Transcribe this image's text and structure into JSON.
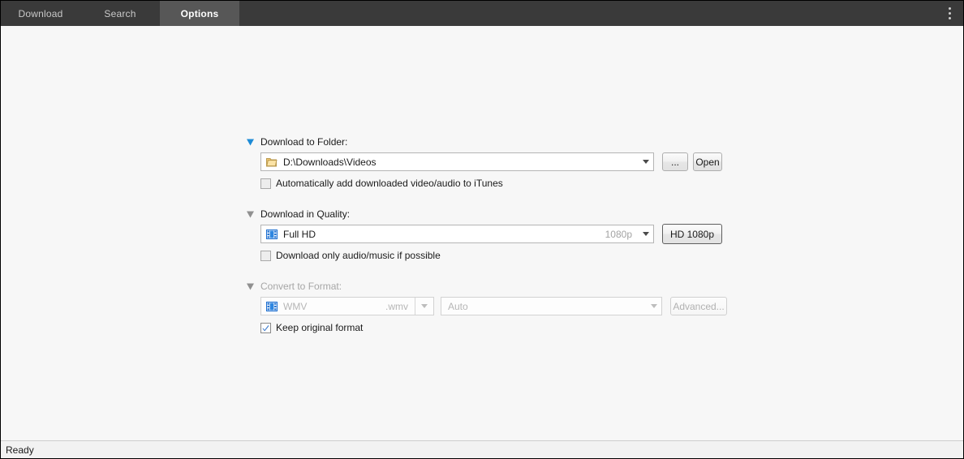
{
  "window": {
    "status_text": "Ready"
  },
  "tabs": [
    {
      "label": "Download",
      "active": false
    },
    {
      "label": "Search",
      "active": false
    },
    {
      "label": "Options",
      "active": true
    }
  ],
  "overflow_menu": {
    "icon": "vertical-ellipsis-icon"
  },
  "options": {
    "download_folder": {
      "header_label": "Download to Folder:",
      "chevron_color": "#1e8bd6",
      "chevron_state": "expanded",
      "combo_icon": "folder-icon",
      "combo_value": "D:\\Downloads\\Videos",
      "browse_button": "...",
      "open_button": "Open",
      "checkbox": {
        "label": "Automatically add downloaded video/audio to iTunes",
        "checked": false
      }
    },
    "download_quality": {
      "header_label": "Download in Quality:",
      "chevron_color": "#909090",
      "chevron_state": "expanded",
      "combo_icon": "film-icon",
      "combo_value": "Full HD",
      "combo_suffix": "1080p",
      "quality_button": "HD 1080p",
      "checkbox": {
        "label": "Download only audio/music if possible",
        "checked": false
      }
    },
    "convert_format": {
      "header_label": "Convert to Format:",
      "chevron_color": "#909090",
      "chevron_state": "expanded",
      "disabled": true,
      "format_icon": "film-icon",
      "format_value": "WMV",
      "format_extension": ".wmv",
      "preset_value": "Auto",
      "advanced_button": "Advanced...",
      "checkbox": {
        "label": "Keep original format",
        "checked": true
      }
    }
  }
}
